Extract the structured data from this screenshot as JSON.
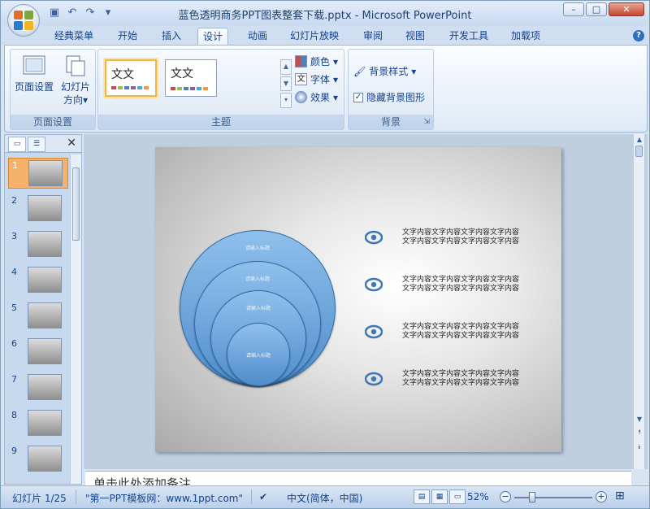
{
  "window": {
    "title": "蓝色透明商务PPT图表整套下载.pptx - Microsoft PowerPoint",
    "minimize_icon": "minimize-icon",
    "maximize_icon": "maximize-icon",
    "close_icon": "close-icon"
  },
  "qat": {
    "save_icon": "save-icon",
    "undo_icon": "undo-icon",
    "redo_icon": "redo-icon",
    "customize_icon": "dropdown-icon"
  },
  "tabs": [
    {
      "label": "经典菜单"
    },
    {
      "label": "开始"
    },
    {
      "label": "插入"
    },
    {
      "label": "设计",
      "active": true
    },
    {
      "label": "动画"
    },
    {
      "label": "幻灯片放映"
    },
    {
      "label": "审阅"
    },
    {
      "label": "视图"
    },
    {
      "label": "开发工具"
    },
    {
      "label": "加载项"
    }
  ],
  "ribbon": {
    "page_setup": {
      "group_label": "页面设置",
      "page_setup_label": "页面设置",
      "orientation_label": "幻灯片",
      "orientation_label2": "方向"
    },
    "themes": {
      "group_label": "主题",
      "thumb_text": "文文",
      "colors_label": "颜色",
      "fonts_label": "字体",
      "effects_label": "效果",
      "fonts_icon_text": "文"
    },
    "background": {
      "group_label": "背景",
      "styles_label": "背景样式",
      "hide_label": "隐藏背景图形",
      "hide_checked": true
    }
  },
  "slides_pane": {
    "slides": [
      {
        "num": "1",
        "selected": true
      },
      {
        "num": "2"
      },
      {
        "num": "3"
      },
      {
        "num": "4"
      },
      {
        "num": "5"
      },
      {
        "num": "6"
      },
      {
        "num": "7"
      },
      {
        "num": "8"
      },
      {
        "num": "9"
      }
    ]
  },
  "slide": {
    "circle_label": "请输入标题",
    "text_line": "文字内容文字内容文字内容文字内容",
    "rows": 4
  },
  "notes": {
    "placeholder": "单击此处添加备注"
  },
  "status": {
    "slide_counter": "幻灯片 1/25",
    "theme_name": "\"第一PPT模板网：www.1ppt.com\"",
    "language": "中文(简体，中国)",
    "zoom": "52%",
    "zoom_fraction": 0.52
  },
  "colors": {
    "accent_blue": "#4f8ccb",
    "selected_thumb": "#f6b26b",
    "theme_swatches": [
      "#c0504d",
      "#9bbb59",
      "#4f81bd",
      "#8064a2",
      "#4bacc6",
      "#f79646"
    ]
  }
}
